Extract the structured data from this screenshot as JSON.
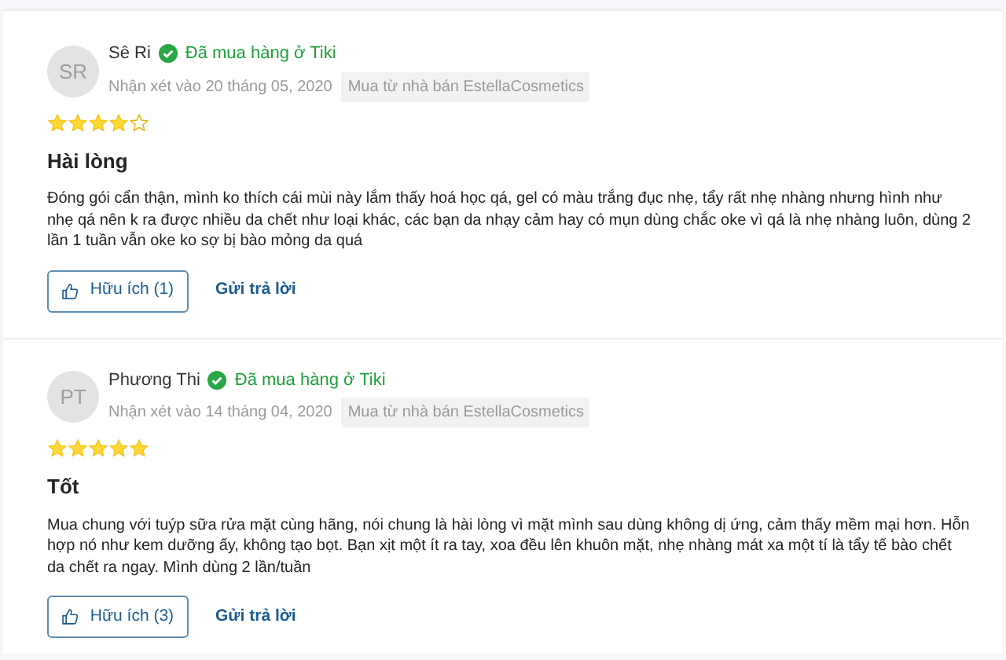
{
  "reviews": [
    {
      "initials": "SR",
      "name": "Sê Ri",
      "badge": "Đã mua hàng ở Tiki",
      "date": "Nhận xét vào 20 tháng 05, 2020",
      "seller": "Mua từ nhà bán EstellaCosmetics",
      "stars": 4,
      "title": "Hài lòng",
      "body": "Đóng gói cẩn thận, mình ko thích cái mùi này lắm thấy hoá học qá, gel có màu trắng đục nhẹ, tẩy rất nhẹ nhàng nhưng hình như nhẹ qá nên k ra được nhiều da chết như loại khác, các bạn da nhạy cảm hay có mụn dùng chắc oke vì qá là nhẹ nhàng luôn, dùng 2 lần 1 tuần vẫn oke ko sợ bị bào mỏng da quá",
      "helpful": "Hữu ích (1)",
      "reply": "Gửi trả lời"
    },
    {
      "initials": "PT",
      "name": "Phương Thi",
      "badge": "Đã mua hàng ở Tiki",
      "date": "Nhận xét vào 14 tháng 04, 2020",
      "seller": "Mua từ nhà bán EstellaCosmetics",
      "stars": 5,
      "title": "Tốt",
      "body": "Mua chung với tuýp sữa rửa mặt cùng hãng, nói chung là hài lòng vì mặt mình sau dùng không dị ứng, cảm thấy mềm mại hơn. Hỗn hợp nó như kem dưỡng ấy, không tạo bọt. Bạn xịt một ít ra tay, xoa đều lên khuôn mặt, nhẹ nhàng mát xa một tí là tẩy tế bào chết da chết ra ngay. Mình dùng 2 lần/tuần",
      "helpful": "Hữu ích (3)",
      "reply": "Gửi trả lời"
    }
  ]
}
